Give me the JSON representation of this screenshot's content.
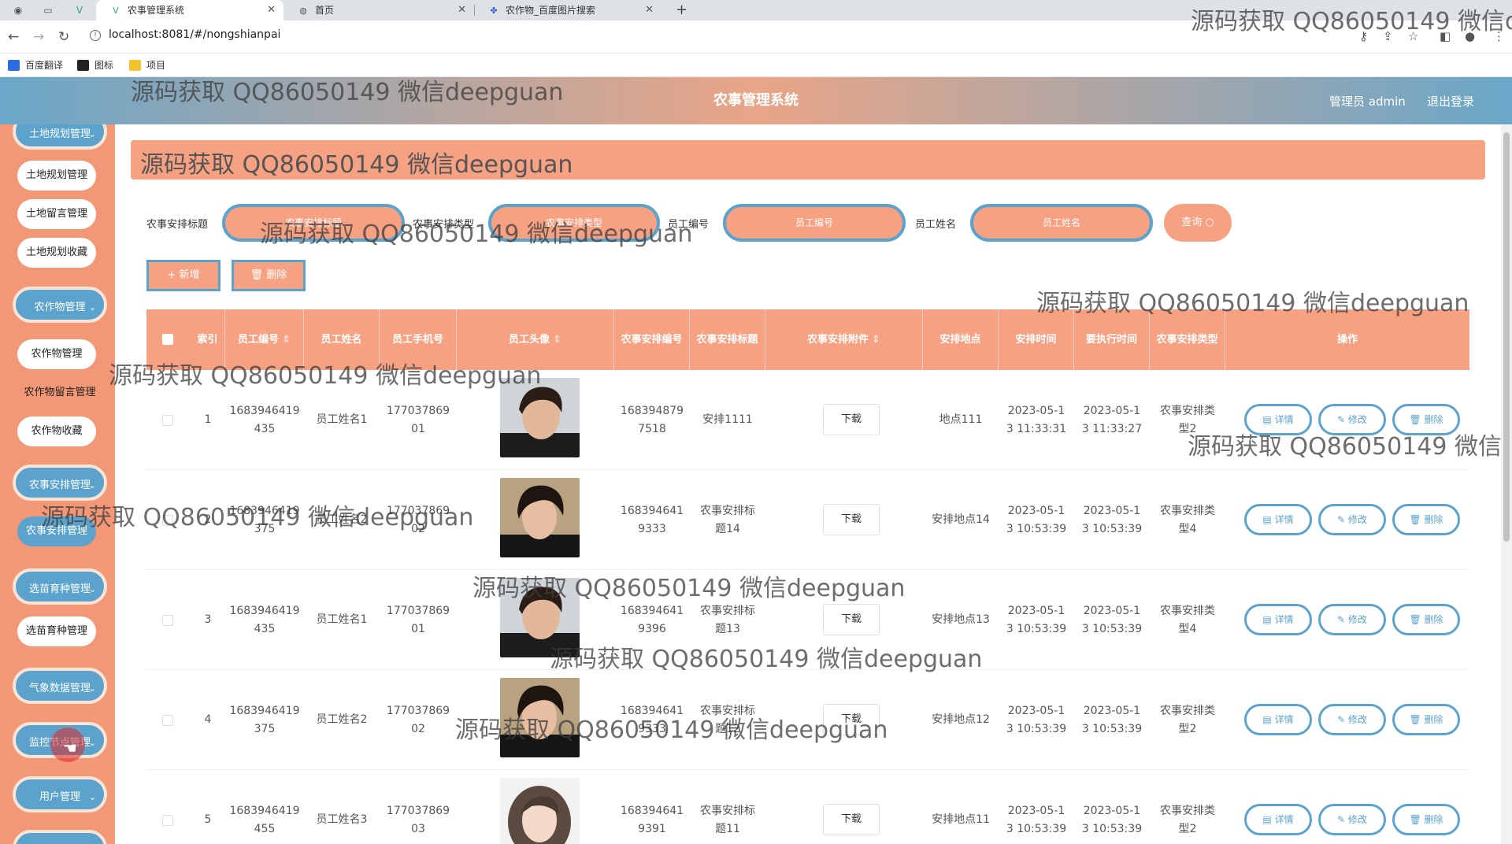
{
  "browser": {
    "tabs": [
      {
        "title": "农事管理系统",
        "active": true
      },
      {
        "title": "首页",
        "active": false
      },
      {
        "title": "农作物_百度图片搜索",
        "active": false
      }
    ],
    "url": "localhost:8081/#/nongshianpai",
    "bookmarks": [
      "百度翻译",
      "图标",
      "项目"
    ],
    "new_tab": "+"
  },
  "header": {
    "title": "农事管理系统",
    "user": "管理员 admin",
    "logout": "退出登录",
    "colors": {
      "accent": "#5ba3cd",
      "primary": "#f7a183",
      "sidebar": "#f29876"
    }
  },
  "sidebar": {
    "groups": [
      {
        "label": "土地规划管理",
        "items": [
          "土地规划管理",
          "土地留言管理",
          "土地规划收藏"
        ]
      },
      {
        "label": "农作物管理",
        "items": [
          "农作物管理",
          "农作物留言管理",
          "农作物收藏"
        ]
      },
      {
        "label": "农事安排管理",
        "items": [
          "农事安排管理"
        ]
      },
      {
        "label": "选苗育种管理",
        "items": [
          "选苗育种管理"
        ]
      },
      {
        "label": "气象数据管理",
        "items": []
      },
      {
        "label": "监控节点管理",
        "items": []
      },
      {
        "label": "用户管理",
        "items": []
      }
    ],
    "chevron": "⌄"
  },
  "banner": {
    "text": "源码获取 QQ86050149 微信deepguan"
  },
  "filters": {
    "fields": [
      {
        "label": "农事安排标题",
        "placeholder": "农事安排标题"
      },
      {
        "label": "农事安排类型",
        "placeholder": "农事安排类型"
      },
      {
        "label": "员工编号",
        "placeholder": "员工编号"
      },
      {
        "label": "员工姓名",
        "placeholder": "员工姓名"
      }
    ],
    "query_button": "查询 ○"
  },
  "actions": {
    "add": "+ 新增",
    "delete": "🗑 删除"
  },
  "table": {
    "headers": [
      "索引",
      "员工编号",
      "员工姓名",
      "员工手机号",
      "员工头像",
      "农事安排编号",
      "农事安排标题",
      "农事安排附件",
      "安排地点",
      "安排时间",
      "要执行时间",
      "农事安排类型",
      "操作"
    ],
    "sort_mark": "⇕",
    "download_label": "下载",
    "op_labels": {
      "detail": "▤ 详情",
      "edit": "✎ 修改",
      "delete": "🗑 删除"
    },
    "rows": [
      {
        "index": "1",
        "emp_no": "1683946419\n435",
        "emp_name": "员工姓名1",
        "phone": "177037869\n01",
        "avatar": "male-1",
        "plan_no": "168394879\n7518",
        "title": "安排1111",
        "place": "地点111",
        "time": "2023-05-1\n3 11:33:31",
        "exec_time": "2023-05-1\n3 11:33:27",
        "type": "农事安排类\n型2"
      },
      {
        "index": "2",
        "emp_no": "1683946419\n375",
        "emp_name": "员工姓名2",
        "phone": "177037869\n02",
        "avatar": "male-2",
        "plan_no": "168394641\n9333",
        "title": "农事安排标\n题14",
        "place": "安排地点14",
        "time": "2023-05-1\n3 10:53:39",
        "exec_time": "2023-05-1\n3 10:53:39",
        "type": "农事安排类\n型4"
      },
      {
        "index": "3",
        "emp_no": "1683946419\n435",
        "emp_name": "员工姓名1",
        "phone": "177037869\n01",
        "avatar": "male-1",
        "plan_no": "168394641\n9396",
        "title": "农事安排标\n题13",
        "place": "安排地点13",
        "time": "2023-05-1\n3 10:53:39",
        "exec_time": "2023-05-1\n3 10:53:39",
        "type": "农事安排类\n型4"
      },
      {
        "index": "4",
        "emp_no": "1683946419\n375",
        "emp_name": "员工姓名2",
        "phone": "177037869\n02",
        "avatar": "male-2",
        "plan_no": "168394641\n9333",
        "title": "农事安排标\n题12",
        "place": "安排地点12",
        "time": "2023-05-1\n3 10:53:39",
        "exec_time": "2023-05-1\n3 10:53:39",
        "type": "农事安排类\n型2"
      },
      {
        "index": "5",
        "emp_no": "1683946419\n455",
        "emp_name": "员工姓名3",
        "phone": "177037869\n03",
        "avatar": "female-1",
        "plan_no": "168394641\n9391",
        "title": "农事安排标\n题11",
        "place": "安排地点11",
        "time": "2023-05-1\n3 10:53:39",
        "exec_time": "2023-05-1\n3 10:53:39",
        "type": "农事安排类\n型2"
      }
    ]
  },
  "watermarks": [
    "源码获取 QQ86050149 微信d",
    "源码获取 QQ86050149 微信deepguan",
    "源码获取 QQ86050149 微信deepguan",
    "源码获取 QQ86050149 微信deepguan",
    "源码获取 QQ86050149 微信deepguan",
    "源码获取 QQ86050149 微信d",
    "源码获取 QQ86050149 微信deepguan",
    "源码获取 QQ86050149 微信deepguan",
    "源码获取 QQ86050149 微信deepguan",
    "源码获取 QQ86050149 微信deepguan"
  ]
}
